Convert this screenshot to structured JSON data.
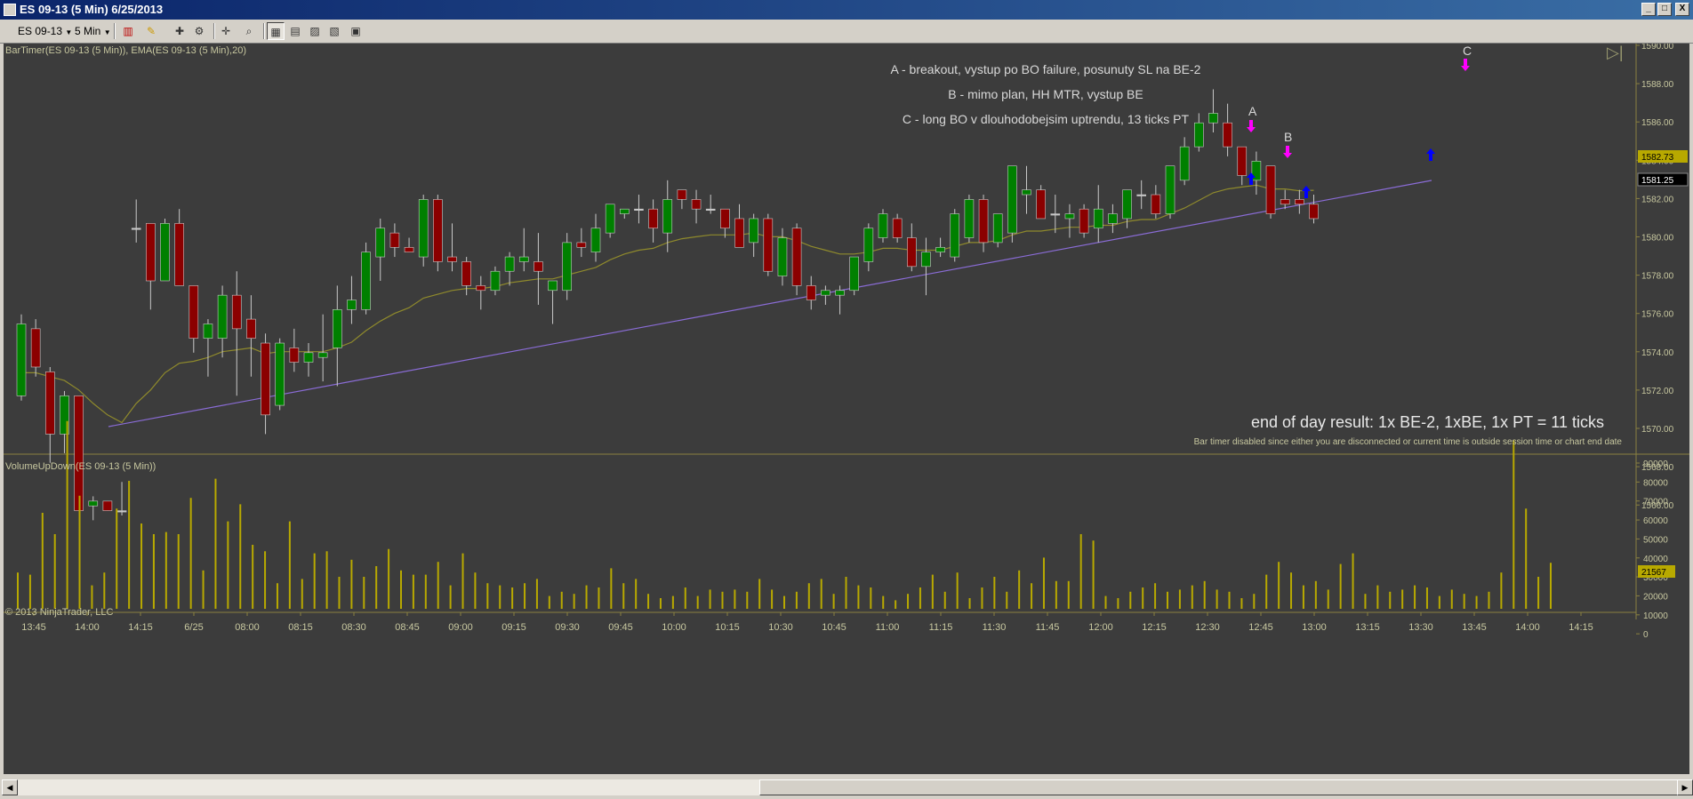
{
  "window": {
    "title": "ES 09-13 (5 Min)  6/25/2013",
    "min_label": "_",
    "max_label": "□",
    "close_label": "X"
  },
  "toolbar": {
    "instrument": "ES 09-13",
    "interval": "5 Min"
  },
  "panels": {
    "price_label": "BarTimer(ES 09-13 (5 Min)), EMA(ES 09-13 (5 Min),20)",
    "volume_label": "VolumeUpDown(ES 09-13 (5 Min))",
    "copyright": "© 2013 NinjaTrader, LLC"
  },
  "annotations": {
    "note_a": "A - breakout, vystup po BO failure, posunuty SL na BE-2",
    "note_b": "B - mimo plan, HH MTR, vystup BE",
    "note_c": "C - long BO v dlouhodobejsim uptrendu, 13 ticks PT",
    "result": "end of day result: 1x BE-2, 1xBE, 1x PT = 11 ticks",
    "bar_timer_msg": "Bar timer disabled since either you are disconnected or current time is outside session time or chart end date",
    "letter_a": "A",
    "letter_b": "B",
    "letter_c": "C"
  },
  "price_axis": {
    "labels": [
      "1590.00",
      "1588.00",
      "1586.00",
      "1584.00",
      "1582.00",
      "1580.00",
      "1578.00",
      "1576.00",
      "1574.00",
      "1572.00",
      "1570.00",
      "1568.00",
      "1566.00"
    ],
    "ema_marker": "1582.73",
    "last_price_marker": "1581.25"
  },
  "volume_axis": {
    "labels": [
      "90000",
      "80000",
      "70000",
      "60000",
      "50000",
      "40000",
      "30000",
      "20000",
      "10000",
      "0"
    ],
    "last_volume_marker": "21567"
  },
  "time_axis": {
    "labels": [
      "13:45",
      "14:00",
      "14:15",
      "6/25",
      "08:00",
      "08:15",
      "08:30",
      "08:45",
      "09:00",
      "09:15",
      "09:30",
      "09:45",
      "10:00",
      "10:15",
      "10:30",
      "10:45",
      "11:00",
      "11:15",
      "11:30",
      "11:45",
      "12:00",
      "12:15",
      "12:30",
      "12:45",
      "13:00",
      "13:15",
      "13:30",
      "13:45",
      "14:00",
      "14:15"
    ]
  },
  "colors": {
    "background": "#3c3c3c",
    "up_candle": "#008000",
    "down_candle": "#8b0000",
    "ema": "#8f8a2c",
    "trendline": "#8a6cd6",
    "volume_bars": "#b8a900",
    "axis_text": "#c8c8a0",
    "note_text": "#d8d8d8",
    "marker": "#ff00ff",
    "entry_arrow": "#0000ff"
  },
  "chart_data": {
    "type": "candlestick",
    "title": "ES 09-13 (5 Min)  6/25/2013",
    "ylim": [
      1565.0,
      1590.25
    ],
    "volume_ylim": [
      0,
      90000
    ],
    "grid": false,
    "ohlc": [
      [
        1572.0,
        1576.25,
        1571.75,
        1575.75
      ],
      [
        1575.5,
        1576.0,
        1573.0,
        1573.5
      ],
      [
        1573.25,
        1573.5,
        1568.5,
        1570.0
      ],
      [
        1570.0,
        1572.25,
        1569.0,
        1572.0
      ],
      [
        1572.0,
        1572.0,
        1566.0,
        1566.0
      ],
      [
        1566.25,
        1566.75,
        1565.5,
        1566.5
      ],
      [
        1566.5,
        1566.5,
        1566.0,
        1566.0
      ],
      [
        1566.0,
        1567.5,
        1565.75,
        1566.0
      ],
      [
        1580.75,
        1582.25,
        1580.0,
        1580.75
      ],
      [
        1581.0,
        1581.0,
        1576.5,
        1578.0
      ],
      [
        1578.0,
        1581.25,
        1578.0,
        1581.0
      ],
      [
        1581.0,
        1581.75,
        1577.75,
        1577.75
      ],
      [
        1577.75,
        1577.75,
        1574.25,
        1575.0
      ],
      [
        1575.0,
        1576.0,
        1573.0,
        1575.75
      ],
      [
        1575.0,
        1577.75,
        1574.0,
        1577.25
      ],
      [
        1577.25,
        1578.5,
        1572.0,
        1575.5
      ],
      [
        1576.0,
        1577.25,
        1573.0,
        1575.0
      ],
      [
        1574.75,
        1575.25,
        1570.0,
        1571.0
      ],
      [
        1571.5,
        1575.0,
        1571.25,
        1574.75
      ],
      [
        1574.5,
        1575.5,
        1573.25,
        1573.75
      ],
      [
        1573.75,
        1574.75,
        1573.0,
        1574.25
      ],
      [
        1574.0,
        1576.25,
        1572.75,
        1574.25
      ],
      [
        1574.5,
        1577.75,
        1572.5,
        1576.5
      ],
      [
        1576.5,
        1578.25,
        1575.75,
        1577.0
      ],
      [
        1576.5,
        1580.0,
        1576.25,
        1579.5
      ],
      [
        1579.25,
        1581.25,
        1578.0,
        1580.75
      ],
      [
        1580.5,
        1581.0,
        1579.25,
        1579.75
      ],
      [
        1579.75,
        1580.25,
        1579.5,
        1579.5
      ],
      [
        1579.25,
        1582.5,
        1578.75,
        1582.25
      ],
      [
        1582.25,
        1582.5,
        1578.5,
        1579.0
      ],
      [
        1579.25,
        1581.0,
        1578.5,
        1579.0
      ],
      [
        1579.0,
        1579.25,
        1577.25,
        1577.75
      ],
      [
        1577.75,
        1578.25,
        1576.5,
        1577.5
      ],
      [
        1577.5,
        1578.75,
        1577.25,
        1578.5
      ],
      [
        1578.5,
        1579.5,
        1577.75,
        1579.25
      ],
      [
        1579.0,
        1580.75,
        1578.5,
        1579.25
      ],
      [
        1579.0,
        1580.5,
        1576.75,
        1578.5
      ],
      [
        1577.5,
        1578.0,
        1575.75,
        1578.0
      ],
      [
        1577.5,
        1580.5,
        1577.0,
        1580.0
      ],
      [
        1580.0,
        1580.75,
        1579.25,
        1579.75
      ],
      [
        1579.5,
        1581.5,
        1579.0,
        1580.75
      ],
      [
        1580.5,
        1582.0,
        1580.25,
        1582.0
      ],
      [
        1581.5,
        1581.75,
        1581.25,
        1581.75
      ],
      [
        1581.75,
        1582.5,
        1581.0,
        1581.75
      ],
      [
        1581.75,
        1582.25,
        1580.0,
        1580.75
      ],
      [
        1580.5,
        1583.25,
        1579.5,
        1582.25
      ],
      [
        1582.75,
        1582.75,
        1581.75,
        1582.25
      ],
      [
        1582.25,
        1582.75,
        1581.0,
        1581.75
      ],
      [
        1581.75,
        1582.5,
        1581.5,
        1581.75
      ],
      [
        1581.75,
        1581.75,
        1580.25,
        1580.75
      ],
      [
        1581.25,
        1582.0,
        1579.75,
        1579.75
      ],
      [
        1580.0,
        1581.5,
        1579.25,
        1581.25
      ],
      [
        1581.25,
        1581.5,
        1578.25,
        1578.5
      ],
      [
        1578.25,
        1580.75,
        1577.75,
        1580.25
      ],
      [
        1580.75,
        1581.0,
        1577.25,
        1577.75
      ],
      [
        1577.75,
        1578.25,
        1576.5,
        1577.0
      ],
      [
        1577.25,
        1577.75,
        1576.75,
        1577.5
      ],
      [
        1577.25,
        1577.75,
        1576.25,
        1577.5
      ],
      [
        1577.5,
        1579.0,
        1577.25,
        1579.25
      ],
      [
        1579.0,
        1581.0,
        1578.5,
        1580.75
      ],
      [
        1580.25,
        1581.75,
        1580.0,
        1581.5
      ],
      [
        1581.25,
        1581.5,
        1580.0,
        1580.25
      ],
      [
        1580.25,
        1581.0,
        1578.5,
        1578.75
      ],
      [
        1578.75,
        1580.25,
        1577.25,
        1579.5
      ],
      [
        1579.5,
        1580.25,
        1579.25,
        1579.75
      ],
      [
        1579.25,
        1581.75,
        1579.0,
        1581.5
      ],
      [
        1580.25,
        1582.5,
        1580.0,
        1582.25
      ],
      [
        1582.25,
        1582.5,
        1579.5,
        1580.0
      ],
      [
        1580.0,
        1581.5,
        1579.75,
        1581.5
      ],
      [
        1580.5,
        1583.5,
        1580.0,
        1584.0
      ],
      [
        1582.5,
        1584.0,
        1581.5,
        1582.75
      ],
      [
        1582.75,
        1583.0,
        1581.25,
        1581.25
      ],
      [
        1581.5,
        1582.5,
        1580.5,
        1581.5
      ],
      [
        1581.25,
        1582.0,
        1580.25,
        1581.5
      ],
      [
        1581.75,
        1582.0,
        1580.25,
        1580.5
      ],
      [
        1580.75,
        1583.0,
        1580.0,
        1581.75
      ],
      [
        1581.0,
        1582.0,
        1580.5,
        1581.5
      ],
      [
        1581.25,
        1582.5,
        1580.75,
        1582.75
      ],
      [
        1582.5,
        1583.25,
        1581.75,
        1582.5
      ],
      [
        1582.5,
        1583.0,
        1581.25,
        1581.5
      ],
      [
        1581.5,
        1584.0,
        1581.25,
        1584.0
      ],
      [
        1583.25,
        1585.5,
        1583.0,
        1585.0
      ],
      [
        1585.0,
        1586.75,
        1584.75,
        1586.25
      ],
      [
        1586.25,
        1588.0,
        1585.75,
        1586.75
      ],
      [
        1586.25,
        1587.25,
        1584.5,
        1585.0
      ],
      [
        1585.0,
        1585.0,
        1583.0,
        1583.5
      ],
      [
        1583.25,
        1584.75,
        1582.5,
        1584.25
      ],
      [
        1584.0,
        1584.0,
        1581.25,
        1581.5
      ],
      [
        1582.25,
        1582.75,
        1581.75,
        1582.0
      ],
      [
        1582.25,
        1582.75,
        1581.5,
        1582.0
      ],
      [
        1582.0,
        1582.5,
        1581.0,
        1581.25
      ]
    ],
    "ema": [
      1573.2,
      1573.2,
      1573.0,
      1572.8,
      1572.3,
      1571.6,
      1571.0,
      1570.6,
      1571.6,
      1572.3,
      1573.2,
      1573.7,
      1573.8,
      1574.0,
      1574.3,
      1574.4,
      1574.5,
      1574.2,
      1574.3,
      1574.3,
      1574.3,
      1574.3,
      1574.5,
      1574.8,
      1575.4,
      1575.9,
      1576.3,
      1576.6,
      1577.1,
      1577.3,
      1577.5,
      1577.6,
      1577.6,
      1577.7,
      1577.9,
      1578.0,
      1578.1,
      1578.1,
      1578.3,
      1578.5,
      1578.7,
      1579.1,
      1579.4,
      1579.6,
      1579.7,
      1580.0,
      1580.2,
      1580.3,
      1580.4,
      1580.4,
      1580.4,
      1580.5,
      1580.3,
      1580.3,
      1580.1,
      1579.8,
      1579.6,
      1579.4,
      1579.4,
      1579.5,
      1579.7,
      1579.7,
      1579.6,
      1579.6,
      1579.6,
      1579.8,
      1580.0,
      1580.0,
      1580.1,
      1580.4,
      1580.6,
      1580.6,
      1580.7,
      1580.8,
      1580.8,
      1580.9,
      1580.9,
      1581.1,
      1581.2,
      1581.2,
      1581.5,
      1581.8,
      1582.2,
      1582.6,
      1582.8,
      1582.9,
      1583.0,
      1582.8,
      1582.8,
      1582.7,
      1582.73
    ],
    "volume": [
      17000,
      16000,
      45000,
      35000,
      88000,
      53000,
      11000,
      17000,
      47000,
      60000,
      40000,
      35000,
      36000,
      35000,
      52000,
      18000,
      61000,
      41000,
      49000,
      30000,
      27000,
      12000,
      41000,
      14000,
      26000,
      27000,
      15000,
      23000,
      15000,
      20000,
      28000,
      18000,
      16000,
      16000,
      22000,
      11000,
      26000,
      17000,
      12000,
      11000,
      10000,
      12000,
      14000,
      6000,
      8000,
      7000,
      11000,
      10000,
      19000,
      12000,
      14000,
      7000,
      5000,
      6000,
      10000,
      6000,
      9000,
      8000,
      9000,
      8000,
      14000,
      9000,
      6000,
      8000,
      12000,
      14000,
      7000,
      15000,
      11000,
      10000,
      6000,
      4000,
      7000,
      10000,
      16000,
      8000,
      17000,
      5000,
      10000,
      15000,
      8000,
      18000,
      12000,
      24000,
      13000,
      13000,
      35000,
      32000,
      6000,
      5000,
      8000,
      10000,
      12000,
      8000,
      9000,
      11000,
      13000,
      9000,
      8000,
      5000,
      7000,
      16000,
      22000,
      17000,
      11000,
      13000,
      9000,
      21000,
      26000,
      7000,
      11000,
      8000,
      9000,
      11000,
      10000,
      6000,
      9000,
      7000,
      6000,
      8000,
      17000,
      79000,
      47000,
      15000,
      21567
    ],
    "trendline": {
      "from": {
        "time_label": "14:15",
        "price": 1565.75
      },
      "to": {
        "time_label": "13:30",
        "price": 1581.25
      }
    },
    "markers": [
      {
        "label": "A",
        "price": 1584.25
      },
      {
        "label": "B",
        "price": 1582.75
      },
      {
        "label": "C",
        "price": 1588.25
      }
    ]
  }
}
